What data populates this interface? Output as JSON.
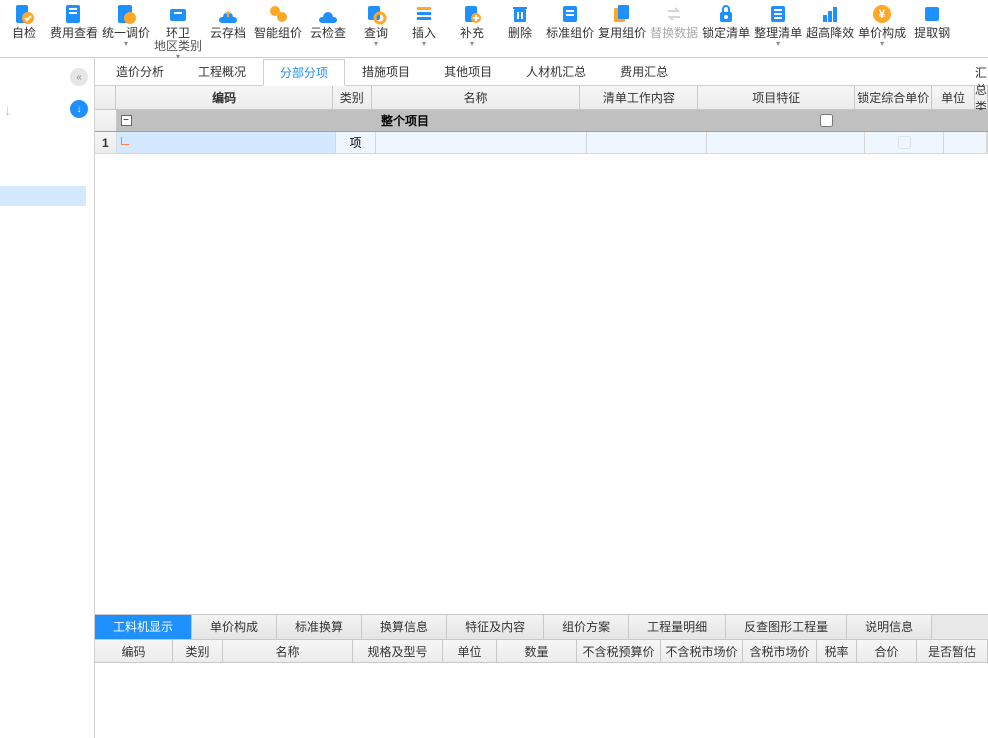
{
  "toolbar": [
    {
      "label": "自检",
      "dropdown": false
    },
    {
      "label": "费用查看",
      "dropdown": false
    },
    {
      "label": "统一调价",
      "dropdown": true
    },
    {
      "label": "环卫",
      "sub": "地区类别",
      "dropdown": true
    },
    {
      "label": "云存档",
      "dropdown": false
    },
    {
      "label": "智能组价",
      "dropdown": false
    },
    {
      "label": "云检查",
      "dropdown": false
    },
    {
      "label": "查询",
      "dropdown": true
    },
    {
      "label": "插入",
      "dropdown": true
    },
    {
      "label": "补充",
      "dropdown": true
    },
    {
      "label": "删除",
      "dropdown": false
    },
    {
      "label": "标准组价",
      "dropdown": false
    },
    {
      "label": "复用组价",
      "dropdown": false
    },
    {
      "label": "替换数据",
      "dropdown": false,
      "disabled": true
    },
    {
      "label": "锁定清单",
      "dropdown": false
    },
    {
      "label": "整理清单",
      "dropdown": true
    },
    {
      "label": "超高降效",
      "dropdown": false
    },
    {
      "label": "单价构成",
      "dropdown": true
    },
    {
      "label": "提取钢",
      "dropdown": false
    }
  ],
  "tabs": [
    "造价分析",
    "工程概况",
    "分部分项",
    "措施项目",
    "其他项目",
    "人材机汇总",
    "费用汇总"
  ],
  "tabs_active": 2,
  "grid": {
    "columns": [
      "编码",
      "类别",
      "名称",
      "清单工作内容",
      "项目特征",
      "锁定综合单价",
      "单位",
      "汇总类别"
    ],
    "group_row": {
      "name": "整个项目"
    },
    "rows": [
      {
        "num": "1",
        "bm": "",
        "lb": "项",
        "mc": "",
        "qd": "",
        "xm": "",
        "sd": false,
        "dw": "",
        "hz": ""
      }
    ]
  },
  "bottom_tabs": [
    "工料机显示",
    "单价构成",
    "标准换算",
    "换算信息",
    "特征及内容",
    "组价方案",
    "工程量明细",
    "反查图形工程量",
    "说明信息"
  ],
  "bottom_tabs_active": 0,
  "bottom_columns": [
    "编码",
    "类别",
    "名称",
    "规格及型号",
    "单位",
    "数量",
    "不含税预算价",
    "不含税市场价",
    "含税市场价",
    "税率",
    "合价",
    "是否暂估"
  ]
}
